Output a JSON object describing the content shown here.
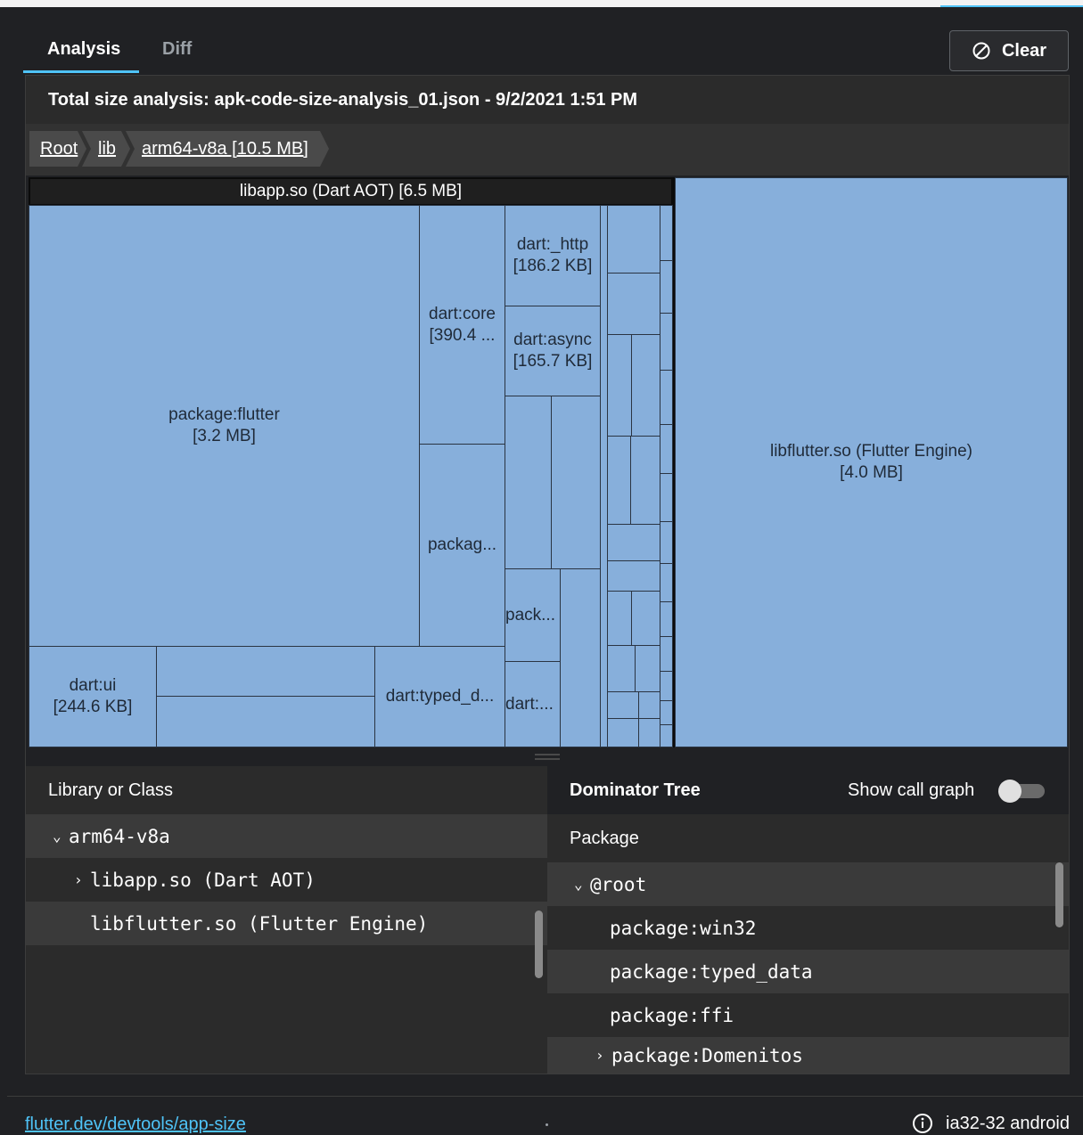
{
  "tabs": {
    "analysis": "Analysis",
    "diff": "Diff"
  },
  "clear_button": {
    "label": "Clear",
    "icon": "block-icon"
  },
  "analysis_title": "Total size analysis: apk-code-size-analysis_01.json - 9/2/2021 1:51 PM",
  "breadcrumbs": [
    "Root",
    "lib",
    "arm64-v8a [10.5 MB]"
  ],
  "treemap": {
    "libapp": {
      "label": "libapp.so (Dart AOT) [6.5 MB]"
    },
    "libflutter": {
      "name": "libflutter.so (Flutter Engine)",
      "size": "[4.0 MB]"
    },
    "package_flutter": {
      "name": "package:flutter",
      "size": "[3.2 MB]"
    },
    "dart_core": {
      "name": "dart:core",
      "size": "[390.4 ..."
    },
    "dart_http": {
      "name": "dart:_http",
      "size": "[186.2 KB]"
    },
    "dart_async": {
      "name": "dart:async",
      "size": "[165.7 KB]"
    },
    "package_trunc": "packag...",
    "pack_trunc": "pack...",
    "dart_trunc": "dart:...",
    "dart_ui": {
      "name": "dart:ui",
      "size": "[244.6 KB]"
    },
    "dart_typed": "dart:typed_d..."
  },
  "left_panel": {
    "header": "Library or Class",
    "rows": [
      {
        "chevron": "⌄",
        "label": "arm64-v8a"
      },
      {
        "chevron": "›",
        "label": "libapp.so (Dart AOT)"
      },
      {
        "chevron": "",
        "label": "libflutter.so (Flutter Engine)"
      }
    ]
  },
  "right_panel": {
    "title": "Dominator Tree",
    "call_graph_label": "Show call graph",
    "call_graph_on": false,
    "column_header": "Package",
    "rows": [
      {
        "chevron": "⌄",
        "label": "@root"
      },
      {
        "chevron": "",
        "label": "package:win32"
      },
      {
        "chevron": "",
        "label": "package:typed_data"
      },
      {
        "chevron": "",
        "label": "package:ffi"
      },
      {
        "chevron": "›",
        "label": "package:Domenitos"
      }
    ]
  },
  "footer": {
    "link": "flutter.dev/devtools/app-size",
    "device": "ia32-32 android",
    "info_icon": "info-icon"
  },
  "colors": {
    "accent": "#4fc3f7",
    "treemap_fill": "#87afdb"
  }
}
